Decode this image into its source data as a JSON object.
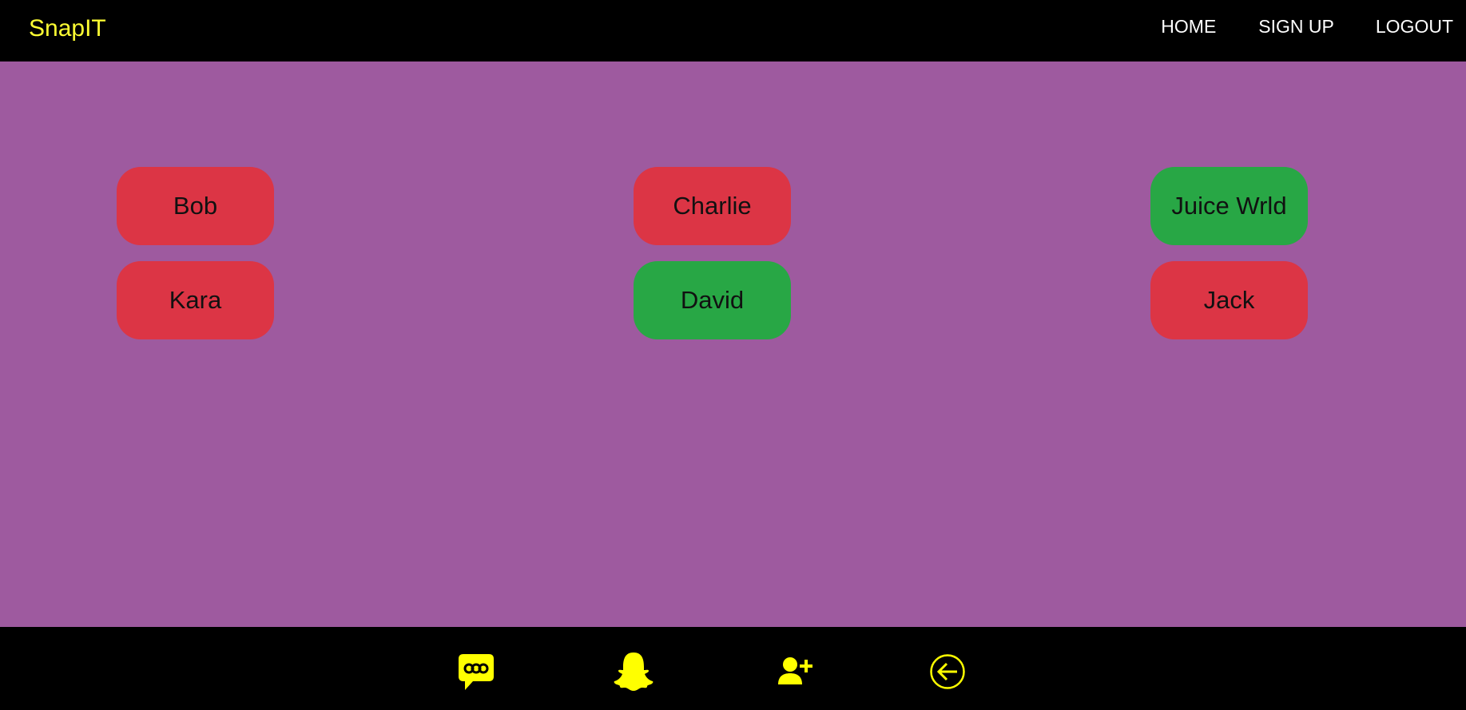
{
  "navbar": {
    "brand": "SnapIT",
    "links": [
      "HOME",
      "SIGN UP",
      "LOGOUT"
    ]
  },
  "friends": [
    {
      "name": "Bob",
      "status": "red"
    },
    {
      "name": "Charlie",
      "status": "red"
    },
    {
      "name": "Juice Wrld",
      "status": "green"
    },
    {
      "name": "Kara",
      "status": "red"
    },
    {
      "name": "David",
      "status": "green"
    },
    {
      "name": "Jack",
      "status": "red"
    }
  ],
  "footer": {
    "icons": [
      "chat-icon",
      "ghost-icon",
      "add-friend-icon",
      "back-arrow-icon"
    ]
  },
  "colors": {
    "background": "#9e5a9f",
    "bars": "#000000",
    "brand": "#ffff33",
    "accent": "#ffff00",
    "red": "#dc3545",
    "green": "#28a745"
  }
}
